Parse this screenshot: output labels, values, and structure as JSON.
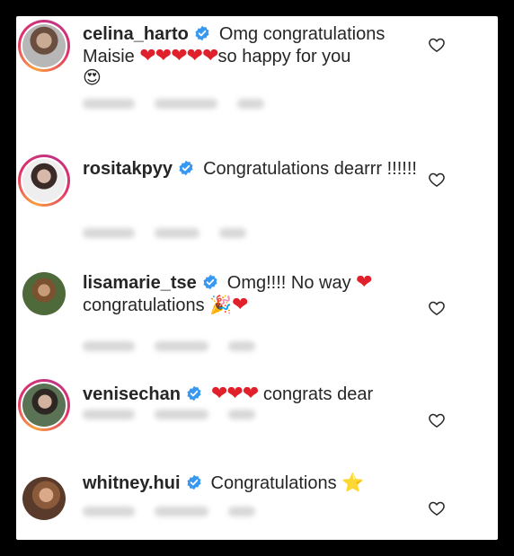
{
  "comments": [
    {
      "username": "celina_harto",
      "text_before": "Omg congratulations Maisie",
      "hearts": "❤❤❤❤❤",
      "text_after": "so happy for you",
      "trailing_emoji": "😍",
      "story_ring": true,
      "avatar_colors": [
        "#b89a86",
        "#5a4338"
      ]
    },
    {
      "username": "rositakpyy",
      "text_before": "Congratulations dearrr !!!!!!",
      "story_ring": true,
      "avatar_colors": [
        "#a38c80",
        "#3a2a28"
      ]
    },
    {
      "username": "lisamarie_tse",
      "text_before": "Omg!!!! No way",
      "hearts": "❤",
      "text_after": "congratulations",
      "trailing_emoji": "🎉",
      "trailing_hearts": "❤",
      "story_ring": false,
      "avatar_colors": [
        "#8b6a3c",
        "#3d5a2a"
      ]
    },
    {
      "username": "venisechan",
      "hearts": "❤❤❤",
      "text_after": "congrats dear",
      "story_ring": true,
      "avatar_colors": [
        "#4d6a4a",
        "#2a3a2e"
      ]
    },
    {
      "username": "whitney.hui",
      "text_before": "Congratulations",
      "trailing_emoji": "⭐",
      "story_ring": false,
      "avatar_colors": [
        "#a37a5a",
        "#5a3a2a"
      ]
    }
  ],
  "colors": {
    "verified_badge": "#3897f0",
    "heart": "#e0202a",
    "text": "#262626"
  },
  "icons": [
    "verified-badge-icon",
    "heart-outline-icon"
  ]
}
